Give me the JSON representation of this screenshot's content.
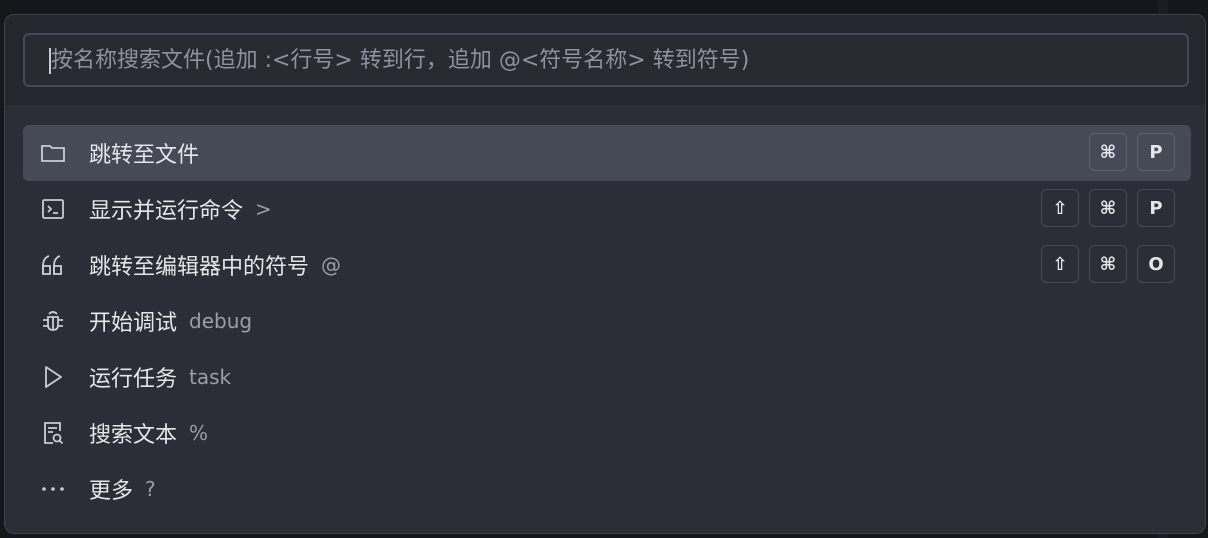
{
  "search": {
    "placeholder": "按名称搜索文件(追加 :<行号> 转到行，追加 @<符号名称> 转到符号)",
    "value": ""
  },
  "items": [
    {
      "icon": "folder-icon",
      "label": "跳转至文件",
      "hint": "",
      "keys": [
        "⌘",
        "P"
      ],
      "selected": true
    },
    {
      "icon": "terminal-icon",
      "label": "显示并运行命令",
      "hint": ">",
      "keys": [
        "⇧",
        "⌘",
        "P"
      ],
      "selected": false
    },
    {
      "icon": "quote-icon",
      "label": "跳转至编辑器中的符号",
      "hint": "@",
      "keys": [
        "⇧",
        "⌘",
        "O"
      ],
      "selected": false
    },
    {
      "icon": "bug-icon",
      "label": "开始调试",
      "hint": "debug",
      "keys": [],
      "selected": false
    },
    {
      "icon": "play-icon",
      "label": "运行任务",
      "hint": "task",
      "keys": [],
      "selected": false
    },
    {
      "icon": "search-file-icon",
      "label": "搜索文本",
      "hint": "%",
      "keys": [],
      "selected": false
    },
    {
      "icon": "ellipsis-icon",
      "label": "更多",
      "hint": "?",
      "keys": [],
      "selected": false
    }
  ]
}
